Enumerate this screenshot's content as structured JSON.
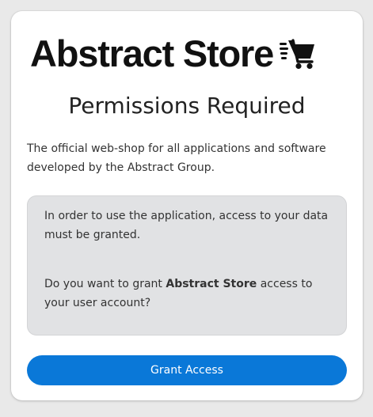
{
  "brand": {
    "name": "Abstract Store",
    "icon": "shopping-cart-fast-icon"
  },
  "dialog": {
    "title": "Permissions Required",
    "description": "The official web-shop for all applications and software developed by the Abstract Group.",
    "notice": {
      "line1": "In order to use the application, access to your data must be granted.",
      "line2_prefix": "Do you want to grant ",
      "line2_app": "Abstract Store",
      "line2_suffix": " access to your user account?"
    },
    "grant_button_label": "Grant Access"
  },
  "colors": {
    "page_background": "#e9e9e9",
    "card_background": "#ffffff",
    "notice_background": "#e1e2e4",
    "button_background": "#0a78d8",
    "button_text": "#ffffff"
  }
}
